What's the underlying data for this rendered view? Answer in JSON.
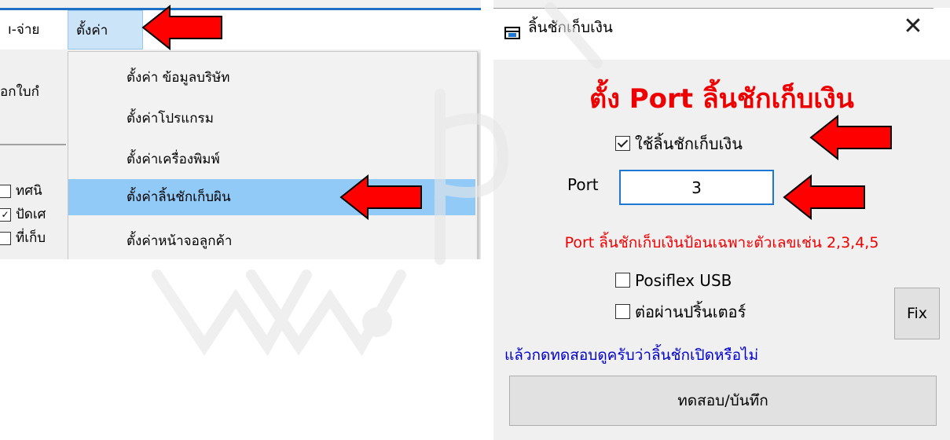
{
  "menu": {
    "prev_item": "ı-จ่าย",
    "settings_item": "ตั้งค่า",
    "toolbar_text": "อกใบกํ",
    "dropdown": [
      "ตั้งค่า ข้อมูลบริษัท",
      "ตั้งค่าโปรแกรม",
      "ตั้งค่าเครื่องพิมพ์",
      "ตั้งค่าลิ้นชักเก็บผิน",
      "ตั้งค่าหน้าจอลูกค้า"
    ],
    "highlighted_index": 3,
    "checklist": [
      {
        "label": "ทศนิ",
        "checked": false
      },
      {
        "label": "ปัดเศ",
        "checked": true
      },
      {
        "label": "ที่เก็บ",
        "checked": false
      }
    ]
  },
  "dialog": {
    "title": "ลิ้นชักเก็บเงิน",
    "close_symbol": "✕",
    "heading": "ตั้ง Port ลิ้นชักเก็บเงิน",
    "use_drawer": {
      "label": "ใช้ลิ้นชักเก็บเงิน",
      "checked": true
    },
    "port_label": "Port",
    "port_value": "3",
    "port_hint": "Port ลิ้นชักเก็บเงินป้อนเฉพาะตัวเลขเช่น 2,3,4,5",
    "posiflex_usb": {
      "label": "Posiflex USB",
      "checked": false
    },
    "via_printer": {
      "label": "ต่อผ่านปริ้นเตอร์",
      "checked": false
    },
    "fix_button": "Fix",
    "test_hint": "แล้วกดทดสอบดูครับว่าลิ้นชักเปิดหรือไม่",
    "save_button": "ทดสอบ/บันทึก"
  },
  "colors": {
    "arrow_fill": "#ff0000",
    "heading": "#ee0000",
    "hint_red": "#ee0000",
    "hint_blue": "#0000cc",
    "menu_highlight": "#91c9f7",
    "input_border": "#1e77d3"
  },
  "icons": {
    "dialog_icon": "drawer-window-icon",
    "close": "close-icon",
    "arrows": "red-arrow-icon"
  }
}
